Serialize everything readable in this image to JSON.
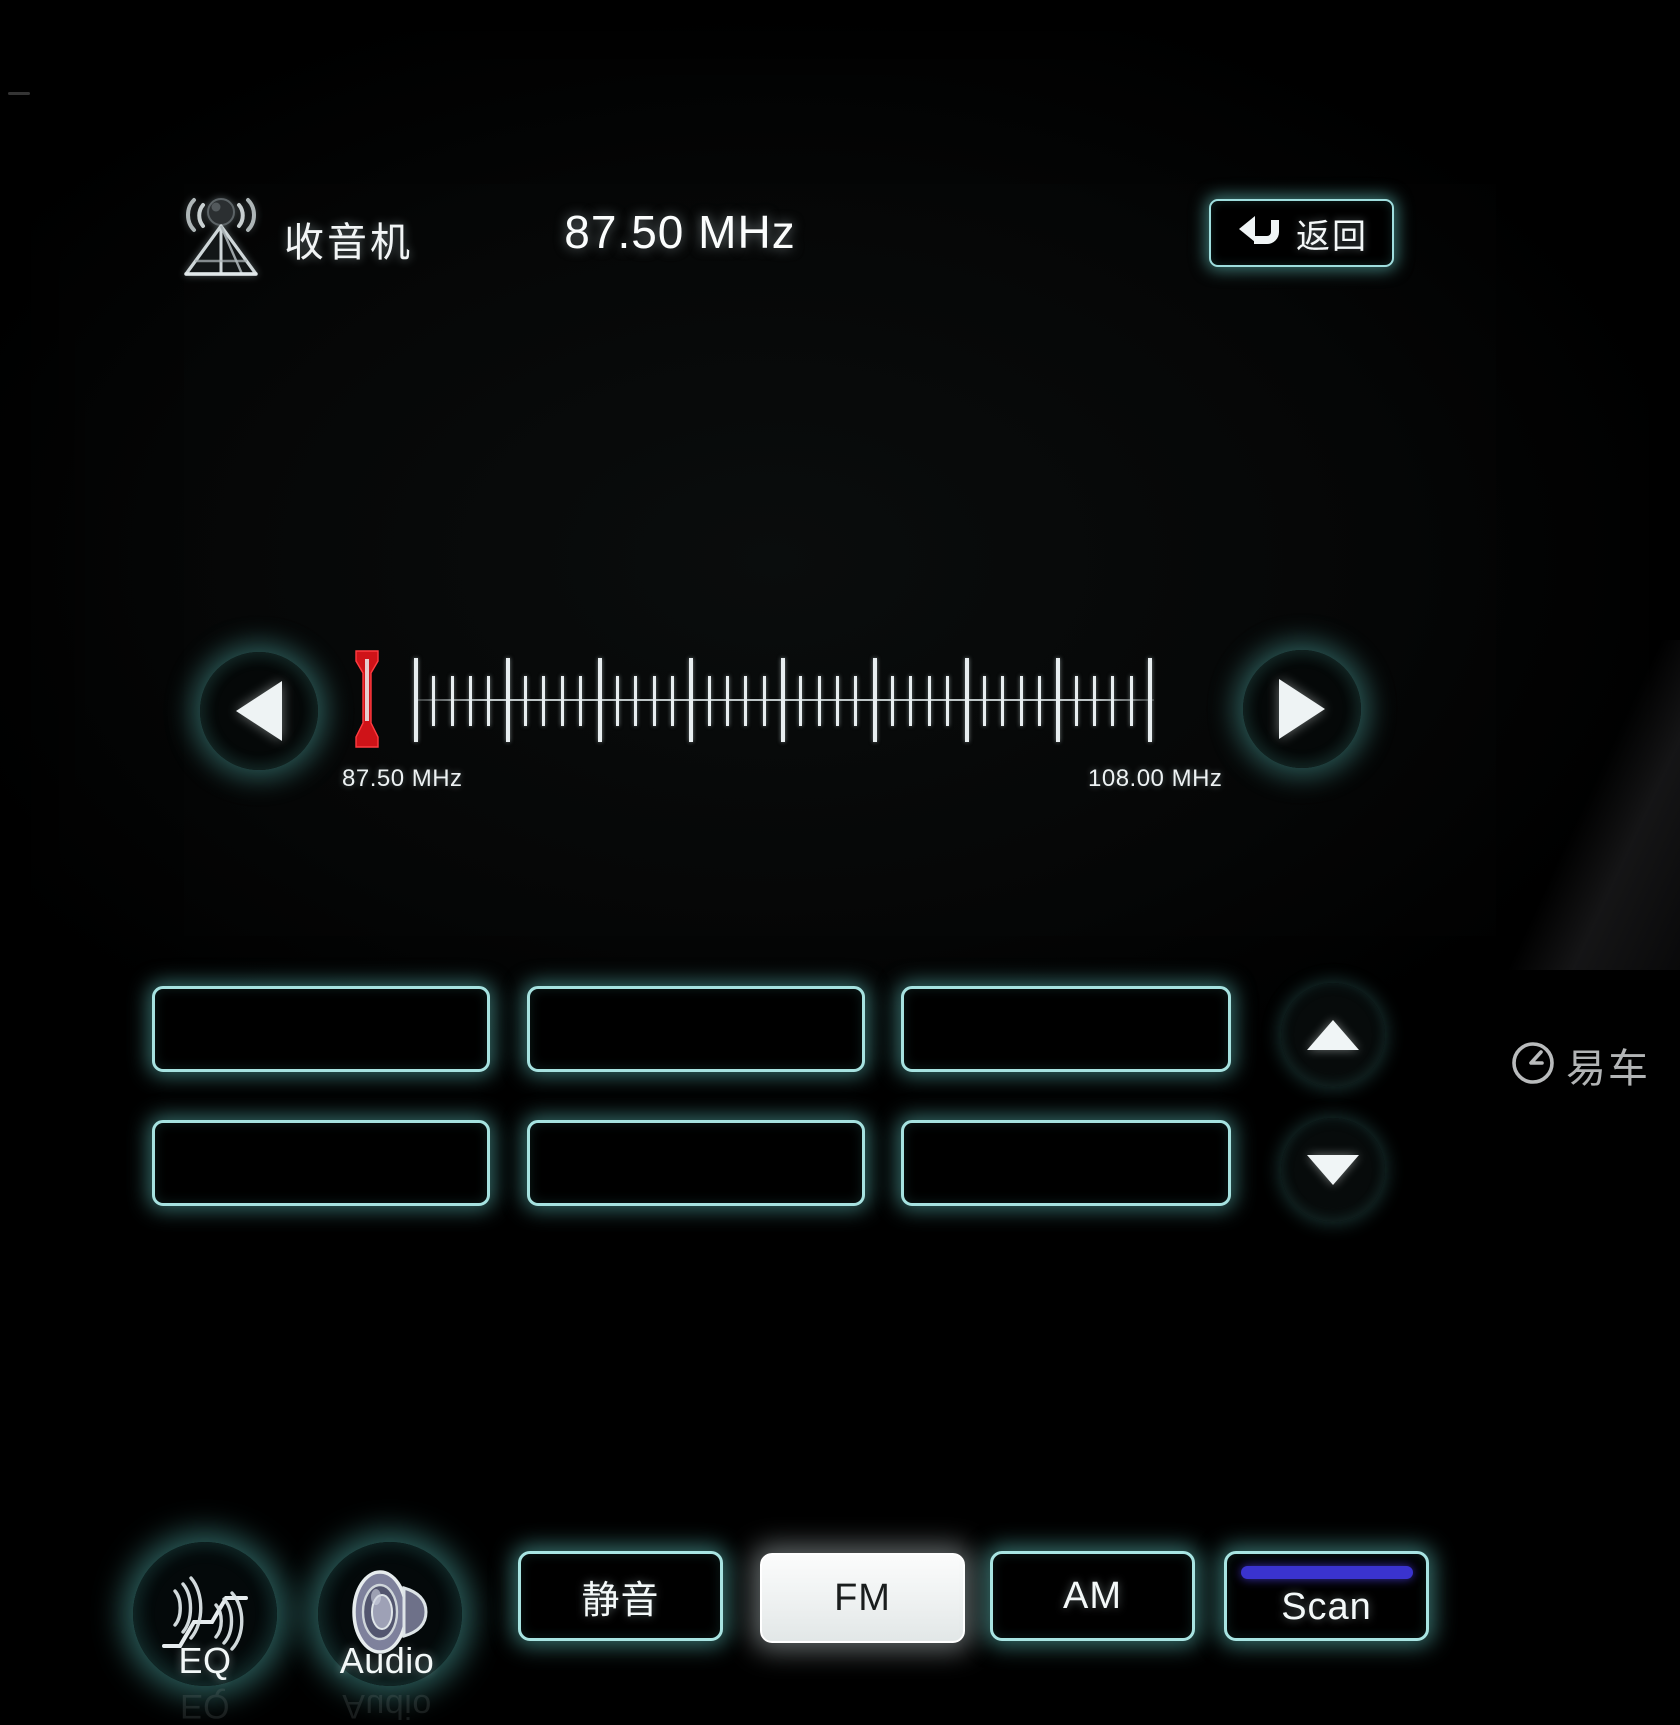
{
  "header": {
    "source_icon": "radio-tower-icon",
    "source_label": "收音机",
    "frequency_display": "87.50 MHz",
    "back_label": "返回",
    "back_icon": "back-arrow-icon"
  },
  "tuner": {
    "prev_icon": "triangle-left-icon",
    "next_icon": "triangle-right-icon",
    "cursor_icon": "red-tuning-cursor-icon",
    "range_low_label": "87.50 MHz",
    "range_high_label": "108.00 MHz",
    "range_min": 87.5,
    "range_max": 108.0,
    "current_value": 87.5,
    "major_tick_every": 5,
    "total_ticks": 41
  },
  "presets": {
    "items": [
      {
        "id": "preset-1",
        "label": ""
      },
      {
        "id": "preset-2",
        "label": ""
      },
      {
        "id": "preset-3",
        "label": ""
      },
      {
        "id": "preset-4",
        "label": ""
      },
      {
        "id": "preset-5",
        "label": ""
      },
      {
        "id": "preset-6",
        "label": ""
      }
    ],
    "page_up_icon": "triangle-up-icon",
    "page_down_icon": "triangle-down-icon"
  },
  "bottombar": {
    "eq": {
      "label": "EQ",
      "icon": "equalizer-icon"
    },
    "audio": {
      "label": "Audio",
      "icon": "speaker-icon"
    },
    "mute_label": "静音",
    "fm_label": "FM",
    "am_label": "AM",
    "scan_label": "Scan",
    "active_band": "FM",
    "scan_progress_percent": 100
  },
  "watermark": {
    "text": "易车",
    "icon": "yiche-logo-icon"
  },
  "colors": {
    "glow_cyan": "#6ed7d2",
    "border_cyan": "#a6e2e0",
    "active_fill": "#eef1f1",
    "scan_bar": "#3a33cf",
    "cursor_red": "#d8161b",
    "background": "#000000",
    "text_light": "#f2f7f7"
  }
}
